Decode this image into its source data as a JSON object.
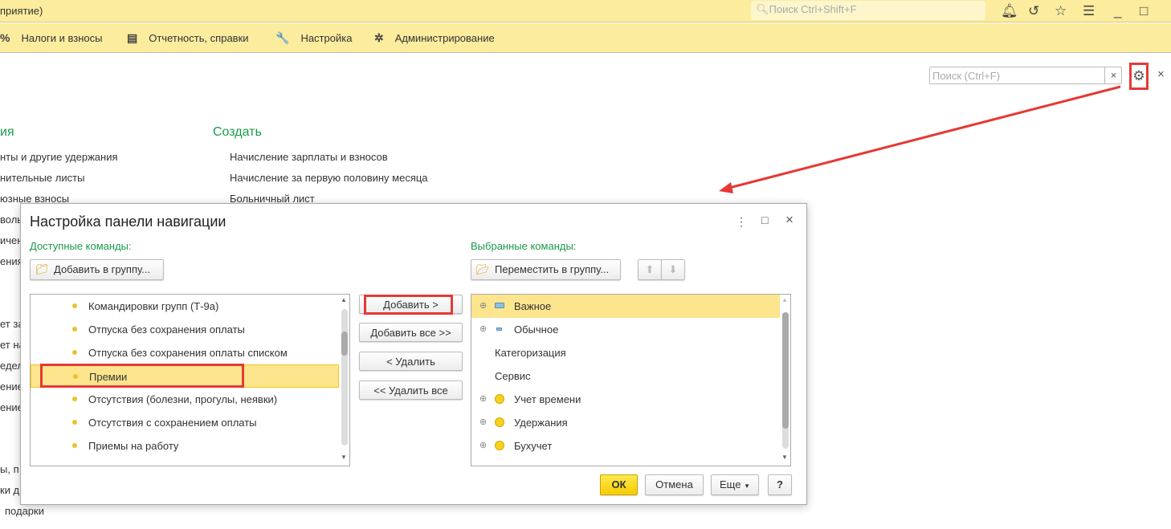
{
  "titlebar": {
    "title": "приятие)",
    "search_placeholder": "Поиск Ctrl+Shift+F"
  },
  "menu": [
    {
      "icon": "percent-icon",
      "glyph": "%",
      "label": "Налоги и взносы"
    },
    {
      "icon": "report-icon",
      "glyph": "▤",
      "label": "Отчетность, справки"
    },
    {
      "icon": "wrench-icon",
      "glyph": "🔧",
      "label": "Настройка"
    },
    {
      "icon": "gear-icon",
      "glyph": "✲",
      "label": "Администрирование"
    }
  ],
  "page": {
    "search_placeholder": "Поиск (Ctrl+F)",
    "left_heading": "ия",
    "left_items": [
      "нты и другие удержания",
      "нительные листы",
      "юзные взносы",
      "воль",
      "ичен",
      "ения",
      "ет за",
      "ет на",
      "едел",
      "ение",
      "ение",
      "ы, п",
      "ки д",
      "подарки"
    ],
    "create_heading": "Создать",
    "create_items": [
      "Начисление зарплаты и взносов",
      "Начисление за первую половину месяца",
      "Больничный лист"
    ]
  },
  "dialog": {
    "title": "Настройка панели навигации",
    "available_label": "Доступные команды:",
    "add_to_group": "Добавить в группу...",
    "available": [
      "Командировки групп (Т-9а)",
      "Отпуска без сохранения оплаты",
      "Отпуска без сохранения оплаты списком",
      "Премии",
      "Отсутствия (болезни, прогулы, неявки)",
      "Отсутствия с сохранением оплаты",
      "Приемы на работу"
    ],
    "selected_available": "Премии",
    "add": "Добавить >",
    "add_all": "Добавить все >>",
    "remove": "< Удалить",
    "remove_all": "<< Удалить все",
    "selected_label": "Выбранные команды:",
    "move_to_group": "Переместить в группу...",
    "selected": [
      {
        "label": "Важное",
        "expand": true,
        "icon": "important"
      },
      {
        "label": "Обычное",
        "expand": true,
        "icon": "normal"
      },
      {
        "label": "Категоризация",
        "expand": false,
        "icon": ""
      },
      {
        "label": "Сервис",
        "expand": false,
        "icon": ""
      },
      {
        "label": "Учет времени",
        "expand": true,
        "icon": "dot"
      },
      {
        "label": "Удержания",
        "expand": true,
        "icon": "dot"
      },
      {
        "label": "Бухучет",
        "expand": true,
        "icon": "dot"
      }
    ],
    "ok": "ОК",
    "cancel": "Отмена",
    "more": "Еще",
    "help": "?"
  },
  "colors": {
    "accent": "#fbec9e",
    "highlight": "#fde58d",
    "green": "#1a9a4a",
    "red": "#e53935"
  }
}
